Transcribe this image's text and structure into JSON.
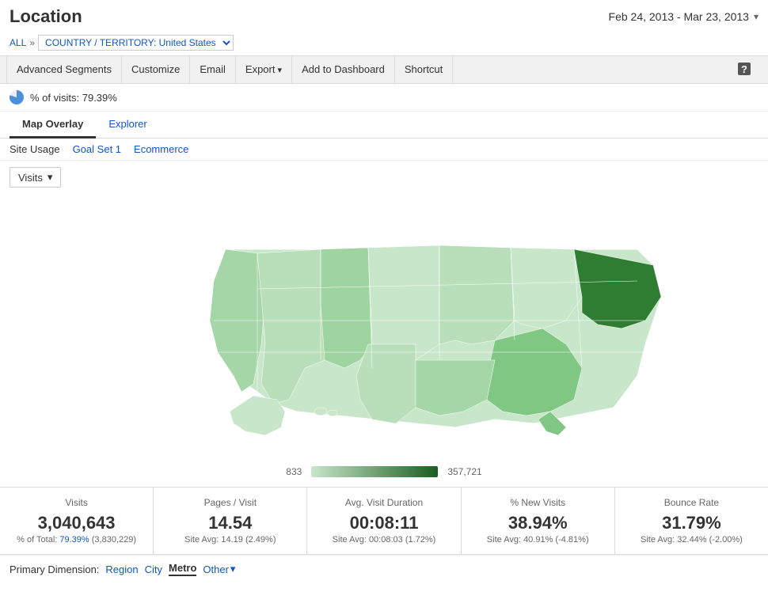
{
  "header": {
    "title": "Location",
    "date_range": "Feb 24, 2013 - Mar 23, 2013"
  },
  "breadcrumb": {
    "all_label": "ALL",
    "separator": "»",
    "filter": "COUNTRY / TERRITORY: United States"
  },
  "toolbar": {
    "advanced_segments": "Advanced Segments",
    "customize": "Customize",
    "email": "Email",
    "export": "Export",
    "add_to_dashboard": "Add to Dashboard",
    "shortcut": "Shortcut"
  },
  "stats_bar": {
    "text": "% of visits: 79.39%"
  },
  "tabs": {
    "map_overlay": "Map Overlay",
    "explorer": "Explorer"
  },
  "sub_tabs": {
    "site_usage": "Site Usage",
    "goal_set_1": "Goal Set 1",
    "ecommerce": "Ecommerce"
  },
  "metric_selector": {
    "label": "Visits",
    "dropdown_icon": "▾"
  },
  "legend": {
    "min": "833",
    "max": "357,721"
  },
  "metrics": [
    {
      "label": "Visits",
      "value": "3,040,643",
      "sub": "% of Total: 79.39% (3,830,229)"
    },
    {
      "label": "Pages / Visit",
      "value": "14.54",
      "sub": "Site Avg: 14.19 (2.49%)"
    },
    {
      "label": "Avg. Visit Duration",
      "value": "00:08:11",
      "sub": "Site Avg: 00:08:03 (1.72%)"
    },
    {
      "label": "% New Visits",
      "value": "38.94%",
      "sub": "Site Avg: 40.91% (-4.81%)"
    },
    {
      "label": "Bounce Rate",
      "value": "31.79%",
      "sub": "Site Avg: 32.44% (-2.00%)"
    }
  ],
  "primary_dimension": {
    "label": "Primary Dimension:",
    "region": "Region",
    "city": "City",
    "metro": "Metro",
    "other": "Other",
    "dropdown_icon": "▾"
  }
}
